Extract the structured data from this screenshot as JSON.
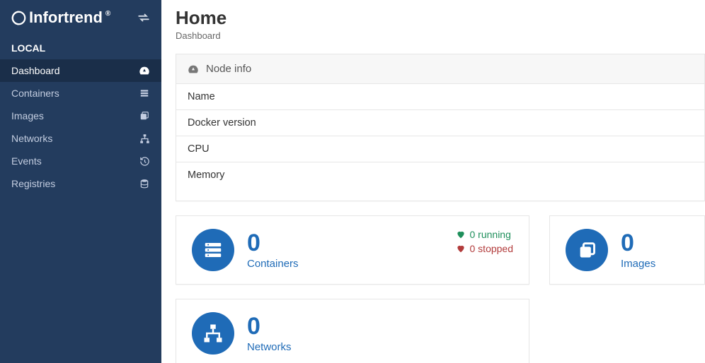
{
  "brand_name": "Infortrend",
  "section_label": "LOCAL",
  "sidebar": {
    "items": [
      {
        "label": "Dashboard",
        "active": true
      },
      {
        "label": "Containers"
      },
      {
        "label": "Images"
      },
      {
        "label": "Networks"
      },
      {
        "label": "Events"
      },
      {
        "label": "Registries"
      }
    ]
  },
  "page": {
    "title": "Home",
    "subtitle": "Dashboard"
  },
  "node_panel": {
    "title": "Node info",
    "rows": [
      "Name",
      "Docker version",
      "CPU",
      "Memory"
    ]
  },
  "tiles": {
    "containers": {
      "count": "0",
      "label": "Containers",
      "running": "0 running",
      "stopped": "0 stopped"
    },
    "images": {
      "count": "0",
      "label": "Images"
    },
    "networks": {
      "count": "0",
      "label": "Networks"
    }
  }
}
